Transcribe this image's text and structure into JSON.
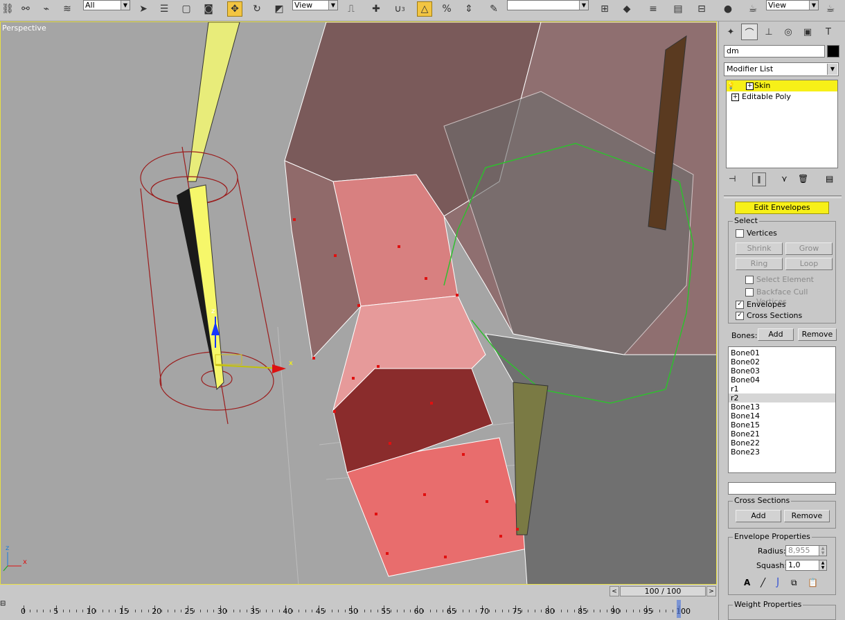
{
  "toolbar": {
    "filter_value": "All",
    "coord_value": "View",
    "coord_value2": "View",
    "snap_label": "3",
    "icons": [
      "select-link-icon",
      "unlink-icon",
      "bind-space-warp-icon",
      "select-object-icon",
      "select-by-name-icon",
      "rect-region-icon",
      "window-crossing-icon",
      "move-icon",
      "rotate-icon",
      "scale-icon",
      "use-pivot-icon",
      "manipulate-icon",
      "snaps-toggle-icon",
      "angle-snap-icon",
      "percent-snap-icon",
      "spinner-snap-icon",
      "edit-named-sets-icon",
      "mirror-icon",
      "align-icon",
      "layer-manager-icon",
      "curve-editor-icon",
      "schematic-view-icon",
      "material-editor-icon",
      "render-scene-icon",
      "quick-render-icon"
    ]
  },
  "viewport": {
    "label": "Perspective",
    "axis_z": "z",
    "axis_x": "x",
    "gizmo_z": "z",
    "gizmo_x": "x"
  },
  "command_panel": {
    "tabs": [
      "create-tab",
      "modify-tab",
      "hierarchy-tab",
      "motion-tab",
      "display-tab",
      "utilities-tab"
    ],
    "object_name": "dm",
    "object_color": "#000000",
    "modifier_list": "Modifier List",
    "stack": [
      {
        "label": "Skin",
        "selected": true
      },
      {
        "label": "Editable Poly",
        "selected": false
      }
    ],
    "edit_envelopes": "Edit Envelopes",
    "select_group": "Select",
    "vertices": "Vertices",
    "shrink": "Shrink",
    "grow": "Grow",
    "ring": "Ring",
    "loop": "Loop",
    "select_element": "Select Element",
    "backface_cull": "Backface Cull Vertices",
    "envelopes": "Envelopes",
    "cross_sections": "Cross Sections",
    "bones_label": "Bones:",
    "bones_add": "Add",
    "bones_remove": "Remove",
    "bones": [
      "Bone01",
      "Bone02",
      "Bone03",
      "Bone04",
      "r1",
      "r2",
      "Bone13",
      "Bone14",
      "Bone15",
      "Bone21",
      "Bone22",
      "Bone23"
    ],
    "selected_bone": "r2",
    "cross_sections_group": "Cross Sections",
    "cs_add": "Add",
    "cs_remove": "Remove",
    "envelope_props": "Envelope Properties",
    "radius_label": "Radius:",
    "radius_value": "8,955",
    "squash_label": "Squash:",
    "squash_value": "1,0",
    "weight_props": "Weight Properties"
  },
  "timeline": {
    "frame_display": "100 / 100",
    "ticks": [
      "0",
      "5",
      "10",
      "15",
      "20",
      "25",
      "30",
      "35",
      "40",
      "45",
      "50",
      "55",
      "60",
      "65",
      "70",
      "75",
      "80",
      "85",
      "90",
      "95",
      "100"
    ],
    "current_frame": 100
  }
}
